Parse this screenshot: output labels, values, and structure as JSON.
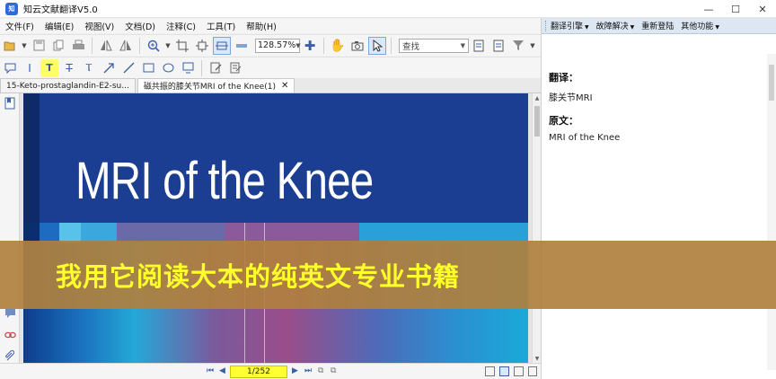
{
  "window": {
    "title": "知云文献翻译V5.0",
    "controls": {
      "minimize": "—",
      "maximize": "☐",
      "close": "✕"
    }
  },
  "menu": {
    "items": [
      "文件(F)",
      "编辑(E)",
      "视图(V)",
      "文档(D)",
      "注释(C)",
      "工具(T)",
      "帮助(H)"
    ]
  },
  "toolbar": {
    "zoom": "128.57%",
    "find": "查找"
  },
  "tabs": [
    {
      "label": "15-Keto-prostaglandin-E2-su..."
    },
    {
      "label": "磁共振的膝关节MRI of the Knee(1)",
      "close": "✕"
    }
  ],
  "document": {
    "book_title": "MRI of the Knee"
  },
  "statusbar": {
    "page": "1/252"
  },
  "right_panel": {
    "toolbar": {
      "engine": "翻译引擎",
      "troubleshoot": "故障解决",
      "relogin": "重新登陆",
      "other": "其他功能"
    },
    "translation_label": "翻译：",
    "translation_text": "膝关节MRI",
    "original_label": "原文：",
    "original_text": "MRI of the Knee"
  },
  "banner": {
    "text": "我用它阅读大本的纯英文专业书籍"
  },
  "colors": {
    "book_cover": "#1b3e93",
    "banner_bg": "#b0803e",
    "banner_text": "#ffff2a",
    "page_box": "#ffff33"
  }
}
